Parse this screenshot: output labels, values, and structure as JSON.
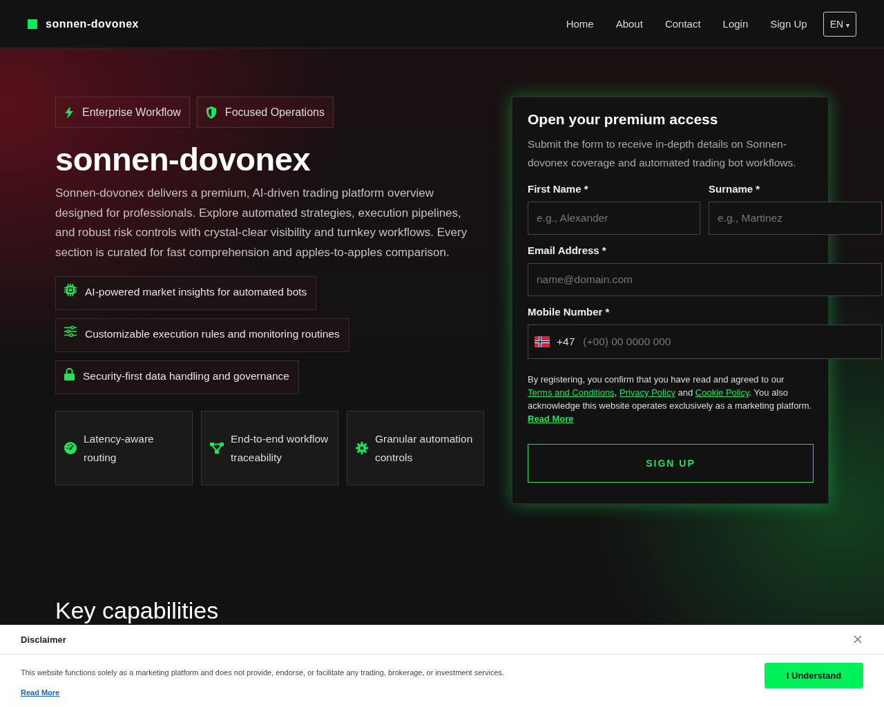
{
  "header": {
    "brand": "sonnen-dovonex",
    "nav": [
      "Home",
      "About",
      "Contact",
      "Login",
      "Sign Up"
    ],
    "language": "EN",
    "language_caret": "▾"
  },
  "hero": {
    "badges": [
      "Enterprise Workflow",
      "Focused Operations"
    ],
    "title": "sonnen-dovonex",
    "description": "Sonnen-dovonex delivers a premium, AI-driven trading platform overview designed for professionals. Explore automated strategies, execution pipelines, and robust risk controls with crystal-clear visibility and turnkey workflows. Every section is curated for fast comprehension and apples-to-apples comparison.",
    "features": [
      "AI-powered market insights for automated bots",
      "Customizable execution rules and monitoring routines",
      "Security-first data handling and governance"
    ],
    "cards": [
      "Latency-aware routing",
      "End-to-end workflow traceability",
      "Granular automation controls"
    ]
  },
  "form": {
    "title": "Open your premium access",
    "subtitle": "Submit the form to receive in-depth details on Sonnen-dovonex coverage and automated trading bot workflows.",
    "fields": [
      {
        "label": "First Name *",
        "placeholder": "e.g., Alexander"
      },
      {
        "label": "Surname *",
        "placeholder": "e.g., Martinez"
      },
      {
        "label": "Email Address *",
        "placeholder": "name@domain.com"
      }
    ],
    "phone": {
      "label": "Mobile Number *",
      "code": "+47",
      "placeholder": "(+00) 00 0000 000"
    },
    "consent": [
      {
        "kind": "text",
        "text": "By registering, you confirm that you have read and agreed to our "
      },
      {
        "kind": "link",
        "text": "Terms and Conditions"
      },
      {
        "kind": "text",
        "text": ", "
      },
      {
        "kind": "link",
        "text": "Privacy Policy"
      },
      {
        "kind": "text",
        "text": " and "
      },
      {
        "kind": "link",
        "text": "Cookie Policy"
      },
      {
        "kind": "text",
        "text": ". You also acknowledge this website operates exclusively as a marketing platform."
      }
    ],
    "read_more": "Read More",
    "button": "SIGN UP"
  },
  "section_heading": "Key capabilities",
  "disclaimer": {
    "title": "Disclaimer",
    "text": "This website functions solely as a marketing platform and does not provide, endorse, or facilitate any trading, brokerage, or investment services.",
    "read_more": "Read More",
    "button": "I Understand"
  }
}
